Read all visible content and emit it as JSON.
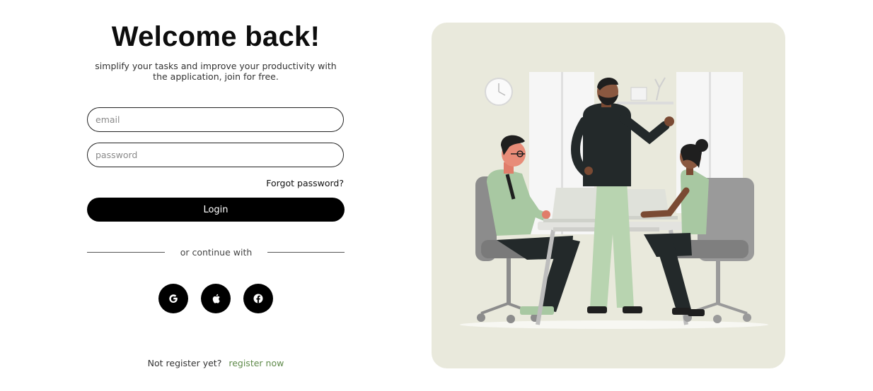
{
  "login": {
    "title": "Welcome back!",
    "subtitle": "simplify your tasks and improve your productivity with the application, join for free.",
    "email_placeholder": "email",
    "password_placeholder": "password",
    "forgot_label": "Forgot password?",
    "login_label": "Login",
    "continue_label": "or continue with",
    "social": [
      "google-icon",
      "apple-icon",
      "facebook-icon"
    ],
    "register_prompt": "Not register yet?",
    "register_link": "register now"
  },
  "colors": {
    "panel_bg": "#e9e9dc",
    "accent_green": "#5f8a4a",
    "button_black": "#000000"
  }
}
